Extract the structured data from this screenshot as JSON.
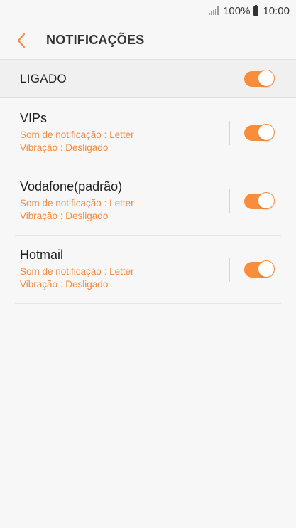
{
  "status_bar": {
    "battery_percent": "100%",
    "time": "10:00"
  },
  "header": {
    "title": "NOTIFICAÇÕES",
    "back_icon": "chevron-left-icon"
  },
  "master_switch": {
    "label": "LIGADO",
    "on": true
  },
  "colors": {
    "accent": "#f98d3b",
    "sub_text": "#f58a3f"
  },
  "accounts": [
    {
      "name": "VIPs",
      "sound": "Som de notificação : Letter",
      "vibration": "Vibração : Desligado",
      "on": true
    },
    {
      "name": "Vodafone(padrão)",
      "sound": "Som de notificação : Letter",
      "vibration": "Vibração : Desligado",
      "on": true
    },
    {
      "name": "Hotmail",
      "sound": "Som de notificação : Letter",
      "vibration": "Vibração : Desligado",
      "on": true
    }
  ]
}
